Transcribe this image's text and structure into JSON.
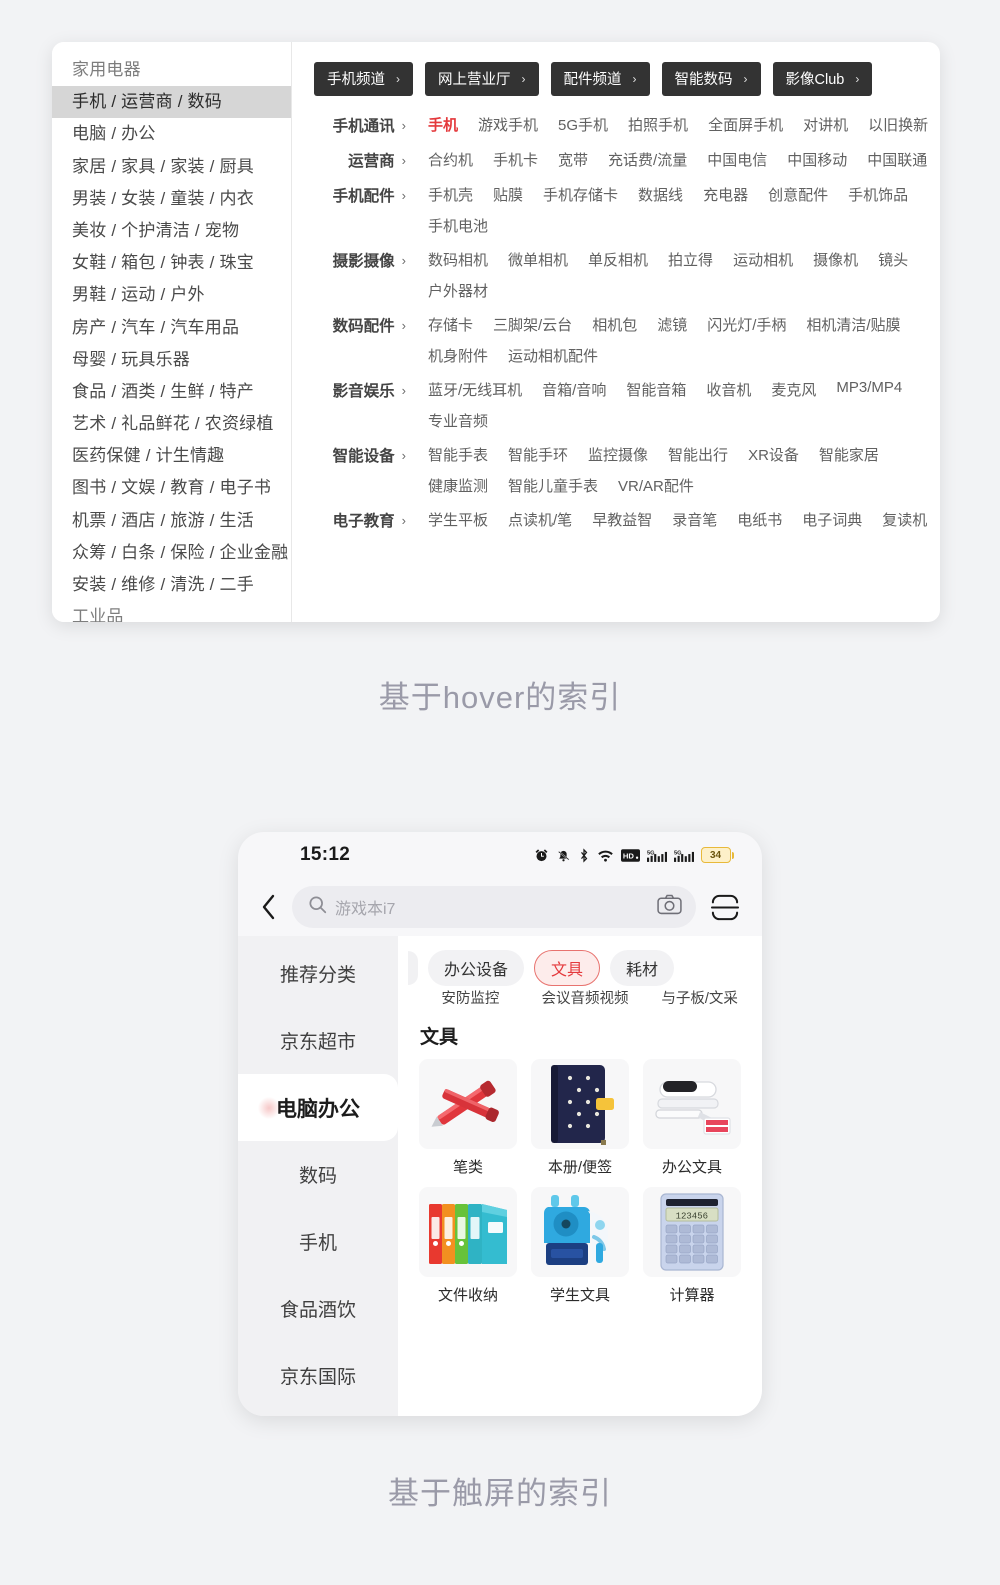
{
  "desktop": {
    "sidebar": {
      "items": [
        {
          "label": "家用电器",
          "active": false
        },
        {
          "label": "手机 / 运营商 / 数码",
          "active": true
        },
        {
          "label": "电脑 / 办公",
          "active": false
        },
        {
          "label": "家居 / 家具 / 家装 / 厨具",
          "active": false
        },
        {
          "label": "男装 / 女装 / 童装 / 内衣",
          "active": false
        },
        {
          "label": "美妆 / 个护清洁 / 宠物",
          "active": false
        },
        {
          "label": "女鞋 / 箱包 / 钟表 / 珠宝",
          "active": false
        },
        {
          "label": "男鞋 / 运动 / 户外",
          "active": false
        },
        {
          "label": "房产 / 汽车 / 汽车用品",
          "active": false
        },
        {
          "label": "母婴 / 玩具乐器",
          "active": false
        },
        {
          "label": "食品 / 酒类 / 生鲜 / 特产",
          "active": false
        },
        {
          "label": "艺术 / 礼品鲜花 / 农资绿植",
          "active": false
        },
        {
          "label": "医药保健 / 计生情趣",
          "active": false
        },
        {
          "label": "图书 / 文娱 / 教育 / 电子书",
          "active": false
        },
        {
          "label": "机票 / 酒店 / 旅游 / 生活",
          "active": false
        },
        {
          "label": "众筹 / 白条 / 保险 / 企业金融",
          "active": false
        },
        {
          "label": "安装 / 维修 / 清洗 / 二手",
          "active": false
        },
        {
          "label": "工业品",
          "active": false
        }
      ]
    },
    "chips": [
      {
        "label": "手机频道"
      },
      {
        "label": "网上营业厅"
      },
      {
        "label": "配件频道"
      },
      {
        "label": "智能数码"
      },
      {
        "label": "影像Club"
      }
    ],
    "chevron": "›",
    "rows": [
      {
        "head": "手机通讯",
        "links": [
          {
            "text": "手机",
            "hot": true
          },
          {
            "text": "游戏手机",
            "hot": false
          },
          {
            "text": "5G手机",
            "hot": false
          },
          {
            "text": "拍照手机",
            "hot": false
          },
          {
            "text": "全面屏手机",
            "hot": false
          },
          {
            "text": "对讲机",
            "hot": false
          },
          {
            "text": "以旧换新",
            "hot": false
          }
        ]
      },
      {
        "head": "运营商",
        "links": [
          {
            "text": "合约机",
            "hot": false
          },
          {
            "text": "手机卡",
            "hot": false
          },
          {
            "text": "宽带",
            "hot": false
          },
          {
            "text": "充话费/流量",
            "hot": false
          },
          {
            "text": "中国电信",
            "hot": false
          },
          {
            "text": "中国移动",
            "hot": false
          },
          {
            "text": "中国联通",
            "hot": false
          }
        ]
      },
      {
        "head": "手机配件",
        "links": [
          {
            "text": "手机壳",
            "hot": false
          },
          {
            "text": "贴膜",
            "hot": false
          },
          {
            "text": "手机存储卡",
            "hot": false
          },
          {
            "text": "数据线",
            "hot": false
          },
          {
            "text": "充电器",
            "hot": false
          },
          {
            "text": "创意配件",
            "hot": false
          },
          {
            "text": "手机饰品",
            "hot": false
          },
          {
            "text": "手机电池",
            "hot": false
          }
        ]
      },
      {
        "head": "摄影摄像",
        "links": [
          {
            "text": "数码相机",
            "hot": false
          },
          {
            "text": "微单相机",
            "hot": false
          },
          {
            "text": "单反相机",
            "hot": false
          },
          {
            "text": "拍立得",
            "hot": false
          },
          {
            "text": "运动相机",
            "hot": false
          },
          {
            "text": "摄像机",
            "hot": false
          },
          {
            "text": "镜头",
            "hot": false
          },
          {
            "text": "户外器材",
            "hot": false
          }
        ]
      },
      {
        "head": "数码配件",
        "links": [
          {
            "text": "存储卡",
            "hot": false
          },
          {
            "text": "三脚架/云台",
            "hot": false
          },
          {
            "text": "相机包",
            "hot": false
          },
          {
            "text": "滤镜",
            "hot": false
          },
          {
            "text": "闪光灯/手柄",
            "hot": false
          },
          {
            "text": "相机清洁/贴膜",
            "hot": false
          },
          {
            "text": "机身附件",
            "hot": false
          },
          {
            "text": "运动相机配件",
            "hot": false
          }
        ]
      },
      {
        "head": "影音娱乐",
        "links": [
          {
            "text": "蓝牙/无线耳机",
            "hot": false
          },
          {
            "text": "音箱/音响",
            "hot": false
          },
          {
            "text": "智能音箱",
            "hot": false
          },
          {
            "text": "收音机",
            "hot": false
          },
          {
            "text": "麦克风",
            "hot": false
          },
          {
            "text": "MP3/MP4",
            "hot": false
          },
          {
            "text": "专业音频",
            "hot": false
          }
        ]
      },
      {
        "head": "智能设备",
        "links": [
          {
            "text": "智能手表",
            "hot": false
          },
          {
            "text": "智能手环",
            "hot": false
          },
          {
            "text": "监控摄像",
            "hot": false
          },
          {
            "text": "智能出行",
            "hot": false
          },
          {
            "text": "XR设备",
            "hot": false
          },
          {
            "text": "智能家居",
            "hot": false
          },
          {
            "text": "健康监测",
            "hot": false
          },
          {
            "text": "智能儿童手表",
            "hot": false
          },
          {
            "text": "VR/AR配件",
            "hot": false
          }
        ]
      },
      {
        "head": "电子教育",
        "links": [
          {
            "text": "学生平板",
            "hot": false
          },
          {
            "text": "点读机/笔",
            "hot": false
          },
          {
            "text": "早教益智",
            "hot": false
          },
          {
            "text": "录音笔",
            "hot": false
          },
          {
            "text": "电纸书",
            "hot": false
          },
          {
            "text": "电子词典",
            "hot": false
          },
          {
            "text": "复读机",
            "hot": false
          }
        ]
      }
    ]
  },
  "captions": {
    "top": "基于hover的索引",
    "bottom": "基于触屏的索引"
  },
  "phone": {
    "statusbar": {
      "time": "15:12",
      "battery_level": "34",
      "icons": [
        "alarm-icon",
        "mute-icon",
        "bluetooth-icon",
        "wifi-icon",
        "hd-voice-icon",
        "signal-5g-1-icon",
        "signal-5g-2-icon",
        "battery-icon"
      ]
    },
    "search": {
      "placeholder": "游戏本i7",
      "back_icon": "back-chevron-icon",
      "search_icon": "search-icon",
      "camera_icon": "camera-icon",
      "scan_icon": "scan-icon"
    },
    "sidebar": {
      "items": [
        {
          "label": "推荐分类",
          "active": false
        },
        {
          "label": "京东超市",
          "active": false
        },
        {
          "label": "电脑办公",
          "active": true
        },
        {
          "label": "数码",
          "active": false
        },
        {
          "label": "手机",
          "active": false
        },
        {
          "label": "食品酒饮",
          "active": false
        },
        {
          "label": "京东国际",
          "active": false
        }
      ]
    },
    "tabs": [
      {
        "label": "办公设备",
        "active": false,
        "sublabel": "安防监控"
      },
      {
        "label": "文具",
        "active": true,
        "sublabel": "会议音频视频"
      },
      {
        "label": "耗材",
        "active": false,
        "sublabel": "与子板/文采"
      }
    ],
    "grid": {
      "title": "文具",
      "cells": [
        {
          "label": "笔类",
          "icon": "red-pen-icon"
        },
        {
          "label": "本册/便签",
          "icon": "notebook-icon"
        },
        {
          "label": "办公文具",
          "icon": "stapler-icon"
        },
        {
          "label": "文件收纳",
          "icon": "binders-icon"
        },
        {
          "label": "学生文具",
          "icon": "pencil-sharpener-icon"
        },
        {
          "label": "计算器",
          "icon": "calculator-icon"
        }
      ]
    }
  },
  "colors": {
    "accent_red": "#e4393c",
    "chip_bg": "#333333",
    "page_bg": "#f2f3f5",
    "caption": "#9a9aa8"
  }
}
